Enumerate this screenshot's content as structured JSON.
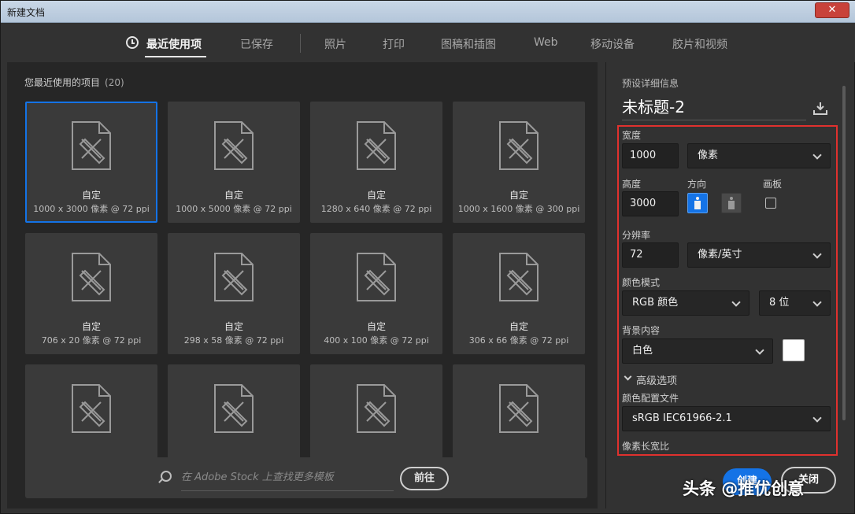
{
  "window": {
    "title": "新建文档",
    "close_label": "✕"
  },
  "tabs": [
    {
      "label": "最近使用项"
    },
    {
      "label": "已保存"
    },
    {
      "label": "照片"
    },
    {
      "label": "打印"
    },
    {
      "label": "图稿和插图"
    },
    {
      "label": "Web"
    },
    {
      "label": "移动设备"
    },
    {
      "label": "胶片和视频"
    }
  ],
  "recent": {
    "header": "您最近使用的项目",
    "count": "(20)",
    "items": [
      {
        "name": "自定",
        "size": "1000 x 3000 像素 @ 72 ppi"
      },
      {
        "name": "自定",
        "size": "1000 x 5000 像素 @ 72 ppi"
      },
      {
        "name": "自定",
        "size": "1280 x 640 像素 @ 72 ppi"
      },
      {
        "name": "自定",
        "size": "1000 x 1600 像素 @ 300 ppi"
      },
      {
        "name": "自定",
        "size": "706 x 20 像素 @ 72 ppi"
      },
      {
        "name": "自定",
        "size": "298 x 58 像素 @ 72 ppi"
      },
      {
        "name": "自定",
        "size": "400 x 100 像素 @ 72 ppi"
      },
      {
        "name": "自定",
        "size": "306 x 66 像素 @ 72 ppi"
      },
      {
        "name": "",
        "size": ""
      },
      {
        "name": "",
        "size": ""
      },
      {
        "name": "",
        "size": ""
      },
      {
        "name": "",
        "size": ""
      }
    ]
  },
  "stock": {
    "placeholder": "在 Adobe Stock 上查找更多模板",
    "goto_label": "前往"
  },
  "details": {
    "section_title": "预设详细信息",
    "doc_name": "未标题-2",
    "width_label": "宽度",
    "width_value": "1000",
    "width_unit": "像素",
    "height_label": "高度",
    "height_value": "3000",
    "orientation_label": "方向",
    "artboard_label": "画板",
    "resolution_label": "分辨率",
    "resolution_value": "72",
    "resolution_unit": "像素/英寸",
    "color_mode_label": "颜色模式",
    "color_mode_value": "RGB 颜色",
    "bit_depth_value": "8 位",
    "background_label": "背景内容",
    "background_value": "白色",
    "background_color": "#ffffff",
    "advanced_label": "高级选项",
    "profile_label": "颜色配置文件",
    "profile_value": "sRGB IEC61966-2.1",
    "aspect_label": "像素长宽比"
  },
  "actions": {
    "create_label": "创建",
    "close_label": "关闭"
  },
  "watermark": "头条 @推优创意",
  "colors": {
    "accent": "#1473e6",
    "highlight": "#e0312e"
  }
}
